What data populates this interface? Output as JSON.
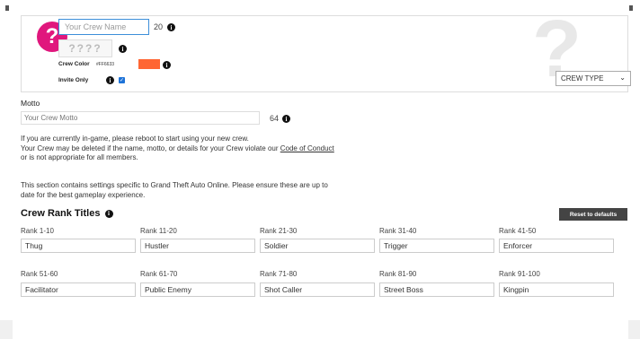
{
  "crew": {
    "name_placeholder": "Your Crew Name",
    "name_counter": "20",
    "tag_placeholder": "????",
    "color_label": "Crew Color",
    "color_hex": "#FF6633",
    "color_value": "#ff6633",
    "invite_only_label": "Invite Only",
    "invite_only_checked": true,
    "emblem_glyph": "?",
    "crew_type_selected": "CREW TYPE"
  },
  "motto": {
    "label": "Motto",
    "placeholder": "Your Crew Motto",
    "counter": "64"
  },
  "notice": {
    "line1": "If you are currently in-game, please reboot to start using your new crew.",
    "line2_pre": "Your Crew may be deleted if the name, motto, or details for your Crew violate our ",
    "line2_link": "Code of Conduct",
    "line3": "or is not appropriate for all members."
  },
  "gta_notice": {
    "line1": "This section contains settings specific to Grand Theft Auto Online. Please ensure these are up to",
    "line2": "date for the best gameplay experience."
  },
  "ranks": {
    "title": "Crew Rank Titles",
    "reset_label": "Reset to defaults",
    "items": [
      {
        "range": "Rank 1-10",
        "title": "Thug"
      },
      {
        "range": "Rank 11-20",
        "title": "Hustler"
      },
      {
        "range": "Rank 21-30",
        "title": "Soldier"
      },
      {
        "range": "Rank 31-40",
        "title": "Trigger"
      },
      {
        "range": "Rank 41-50",
        "title": "Enforcer"
      },
      {
        "range": "Rank 51-60",
        "title": "Facilitator"
      },
      {
        "range": "Rank 61-70",
        "title": "Public Enemy"
      },
      {
        "range": "Rank 71-80",
        "title": "Shot Caller"
      },
      {
        "range": "Rank 81-90",
        "title": "Street Boss"
      },
      {
        "range": "Rank 91-100",
        "title": "Kingpin"
      }
    ]
  }
}
